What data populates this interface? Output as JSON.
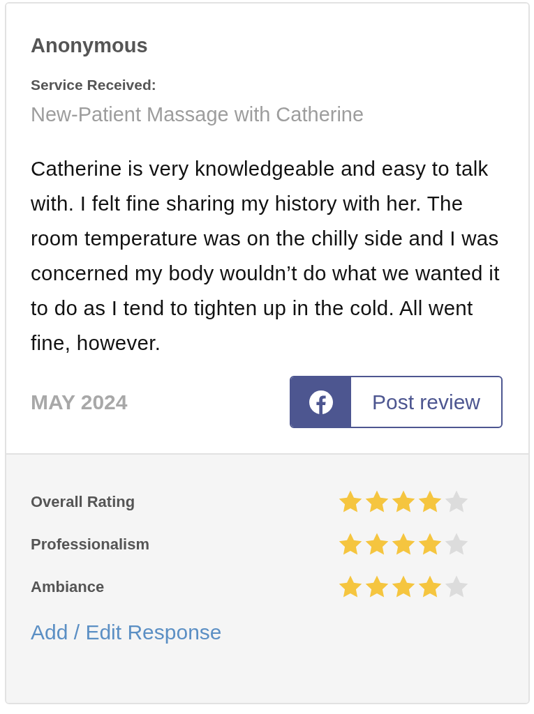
{
  "reviewer": "Anonymous",
  "service_label": "Service Received:",
  "service": "New-Patient Massage with Catherine",
  "review_text": "Catherine is very knowledgeable and easy to talk with. I felt fine sharing my history with her. The room temperature was on the chilly side and I was concerned my body wouldn’t do what we wanted it to do as I tend to tighten up in the cold. All went fine, however.",
  "date": "MAY 2024",
  "share_button": {
    "label": "Post review"
  },
  "ratings": [
    {
      "label": "Overall Rating",
      "stars": 4
    },
    {
      "label": "Professionalism",
      "stars": 4
    },
    {
      "label": "Ambiance",
      "stars": 4
    }
  ],
  "response_link": "Add / Edit Response"
}
